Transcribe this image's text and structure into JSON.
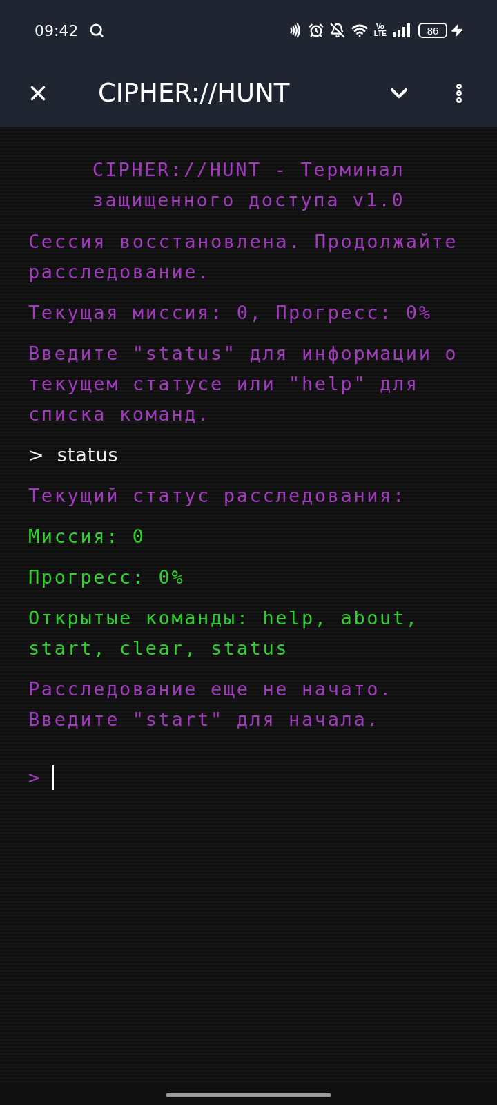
{
  "status_bar": {
    "time": "09:42",
    "volte_top": "Vo",
    "volte_bottom": "LTE",
    "battery": "86"
  },
  "toolbar": {
    "title": "CIPHER://HUNT"
  },
  "terminal": {
    "banner": [
      "CIPHER://HUNT - Терминал",
      "защищенного доступа v1.0"
    ],
    "lines": [
      {
        "kind": "system",
        "text": "Сессия восстановлена. Продолжайте расследование."
      },
      {
        "kind": "system",
        "text": "Текущая миссия: 0, Прогресс: 0%"
      },
      {
        "kind": "system",
        "text": "Введите \"status\" для информации о текущем статусе или \"help\" для списка команд."
      },
      {
        "kind": "command",
        "prompt": ">",
        "text": "status"
      },
      {
        "kind": "system",
        "text": "Текущий статус расследования:"
      },
      {
        "kind": "info",
        "text": "Миссия: 0"
      },
      {
        "kind": "info",
        "text": "Прогресс: 0%"
      },
      {
        "kind": "info",
        "text": "Открытые команды: help, about, start, clear, status"
      },
      {
        "kind": "system",
        "text": "Расследование еще не начато. Введите \"start\" для начала."
      }
    ],
    "input": {
      "prompt": ">"
    }
  }
}
